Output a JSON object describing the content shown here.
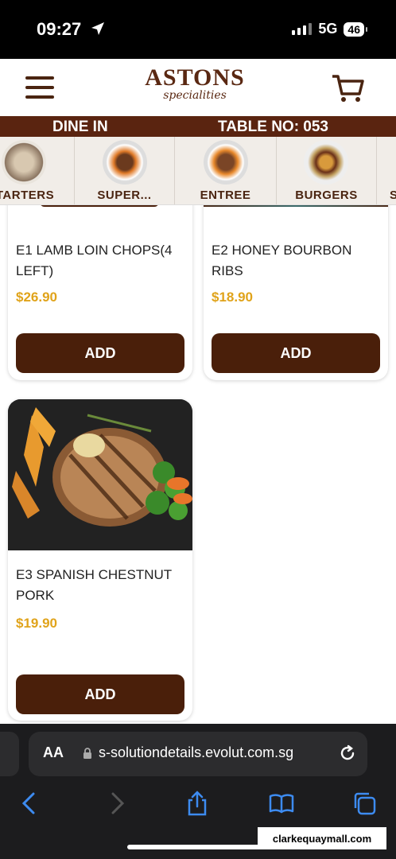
{
  "status_bar": {
    "time": "09:27",
    "network": "5G",
    "battery": "46"
  },
  "header": {
    "logo_main": "ASTONS",
    "logo_sub": "specialities",
    "dine_mode": "DINE IN",
    "table": "TABLE NO: 053"
  },
  "categories": [
    {
      "label": "TARTERS"
    },
    {
      "label": "SUPER..."
    },
    {
      "label": "ENTREE"
    },
    {
      "label": "BURGERS"
    },
    {
      "label": "S"
    }
  ],
  "menu_items": [
    {
      "name": "E1 LAMB LOIN CHOPS(4 LEFT)",
      "price": "$26.90",
      "button": "ADD"
    },
    {
      "name": "E2 HONEY BOURBON RIBS",
      "price": "$18.90",
      "button": "ADD"
    },
    {
      "name": "E3 SPANISH CHESTNUT PORK",
      "price": "$19.90",
      "button": "ADD"
    }
  ],
  "browser": {
    "aa_label": "AA",
    "url": "s-solutiondetails.evolut.com.sg"
  },
  "watermark": "clarkequaymall.com",
  "colors": {
    "brand_brown": "#4a1f0a",
    "price_gold": "#e0a31a",
    "category_bg": "#f1ede8"
  }
}
